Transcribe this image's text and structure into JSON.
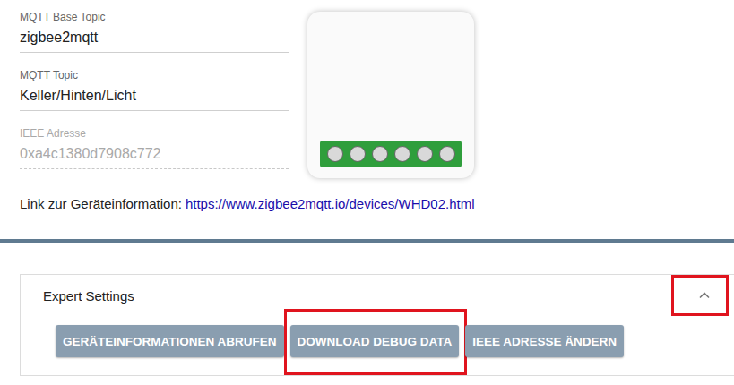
{
  "fields": [
    {
      "label": "MQTT Base Topic",
      "value": "zigbee2mqtt",
      "disabled": false
    },
    {
      "label": "MQTT Topic",
      "value": "Keller/Hinten/Licht",
      "disabled": false
    },
    {
      "label": "IEEE Adresse",
      "value": "0xa4c1380d7908c772",
      "disabled": true
    }
  ],
  "device_info": {
    "label": "Link zur Geräteinformation:",
    "url": "https://www.zigbee2mqtt.io/devices/WHD02.html"
  },
  "expert_settings": {
    "title": "Expert Settings",
    "expanded": true,
    "chevron_highlighted": true,
    "buttons": [
      {
        "label": "GERÄTEINFORMATIONEN ABRUFEN",
        "highlighted": false
      },
      {
        "label": "DOWNLOAD DEBUG DATA",
        "highlighted": true
      },
      {
        "label": "IEEE ADRESSE ÄNDERN",
        "highlighted": false
      }
    ]
  }
}
